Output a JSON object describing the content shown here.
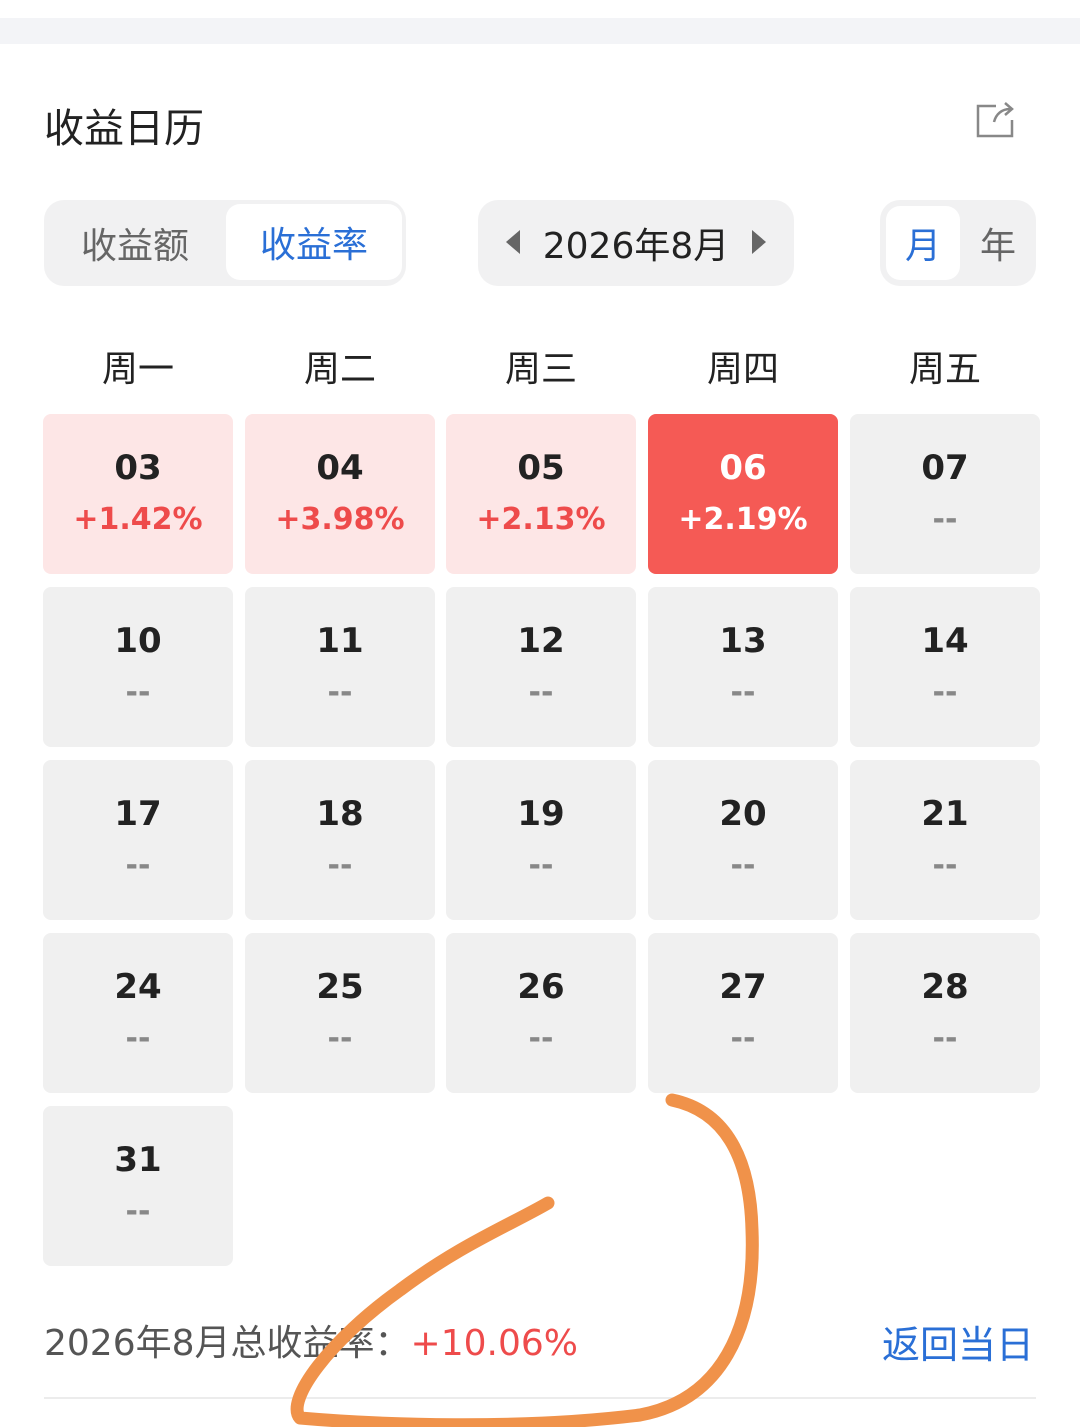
{
  "header": {
    "title": "收益日历",
    "share_icon": "share-icon"
  },
  "toggle": {
    "amount_label": "收益额",
    "rate_label": "收益率",
    "selected": "收益率"
  },
  "month_nav": {
    "label": "2026年8月",
    "prev_icon": "chevron-left-icon",
    "next_icon": "chevron-right-icon"
  },
  "period": {
    "month_label": "月",
    "year_label": "年",
    "selected": "月"
  },
  "weekdays": [
    "周一",
    "周二",
    "周三",
    "周四",
    "周五"
  ],
  "days": [
    {
      "day": "03",
      "value": "+1.42%",
      "state": "gain"
    },
    {
      "day": "04",
      "value": "+3.98%",
      "state": "gain"
    },
    {
      "day": "05",
      "value": "+2.13%",
      "state": "gain"
    },
    {
      "day": "06",
      "value": "+2.19%",
      "state": "selected"
    },
    {
      "day": "07",
      "value": "--",
      "state": "empty"
    },
    {
      "day": "10",
      "value": "--",
      "state": "empty"
    },
    {
      "day": "11",
      "value": "--",
      "state": "empty"
    },
    {
      "day": "12",
      "value": "--",
      "state": "empty"
    },
    {
      "day": "13",
      "value": "--",
      "state": "empty"
    },
    {
      "day": "14",
      "value": "--",
      "state": "empty"
    },
    {
      "day": "17",
      "value": "--",
      "state": "empty"
    },
    {
      "day": "18",
      "value": "--",
      "state": "empty"
    },
    {
      "day": "19",
      "value": "--",
      "state": "empty"
    },
    {
      "day": "20",
      "value": "--",
      "state": "empty"
    },
    {
      "day": "21",
      "value": "--",
      "state": "empty"
    },
    {
      "day": "24",
      "value": "--",
      "state": "empty"
    },
    {
      "day": "25",
      "value": "--",
      "state": "empty"
    },
    {
      "day": "26",
      "value": "--",
      "state": "empty"
    },
    {
      "day": "27",
      "value": "--",
      "state": "empty"
    },
    {
      "day": "28",
      "value": "--",
      "state": "empty"
    },
    {
      "day": "31",
      "value": "--",
      "state": "empty"
    }
  ],
  "summary": {
    "label": "2026年8月总收益率：",
    "value": "+10.06%"
  },
  "back_today_label": "返回当日",
  "colors": {
    "accent_blue": "#2a6fd6",
    "gain_red": "#ee4b4b",
    "selected_red": "#f55a55",
    "gain_bg": "#fde6e6",
    "annotation_orange": "#f0924a"
  }
}
